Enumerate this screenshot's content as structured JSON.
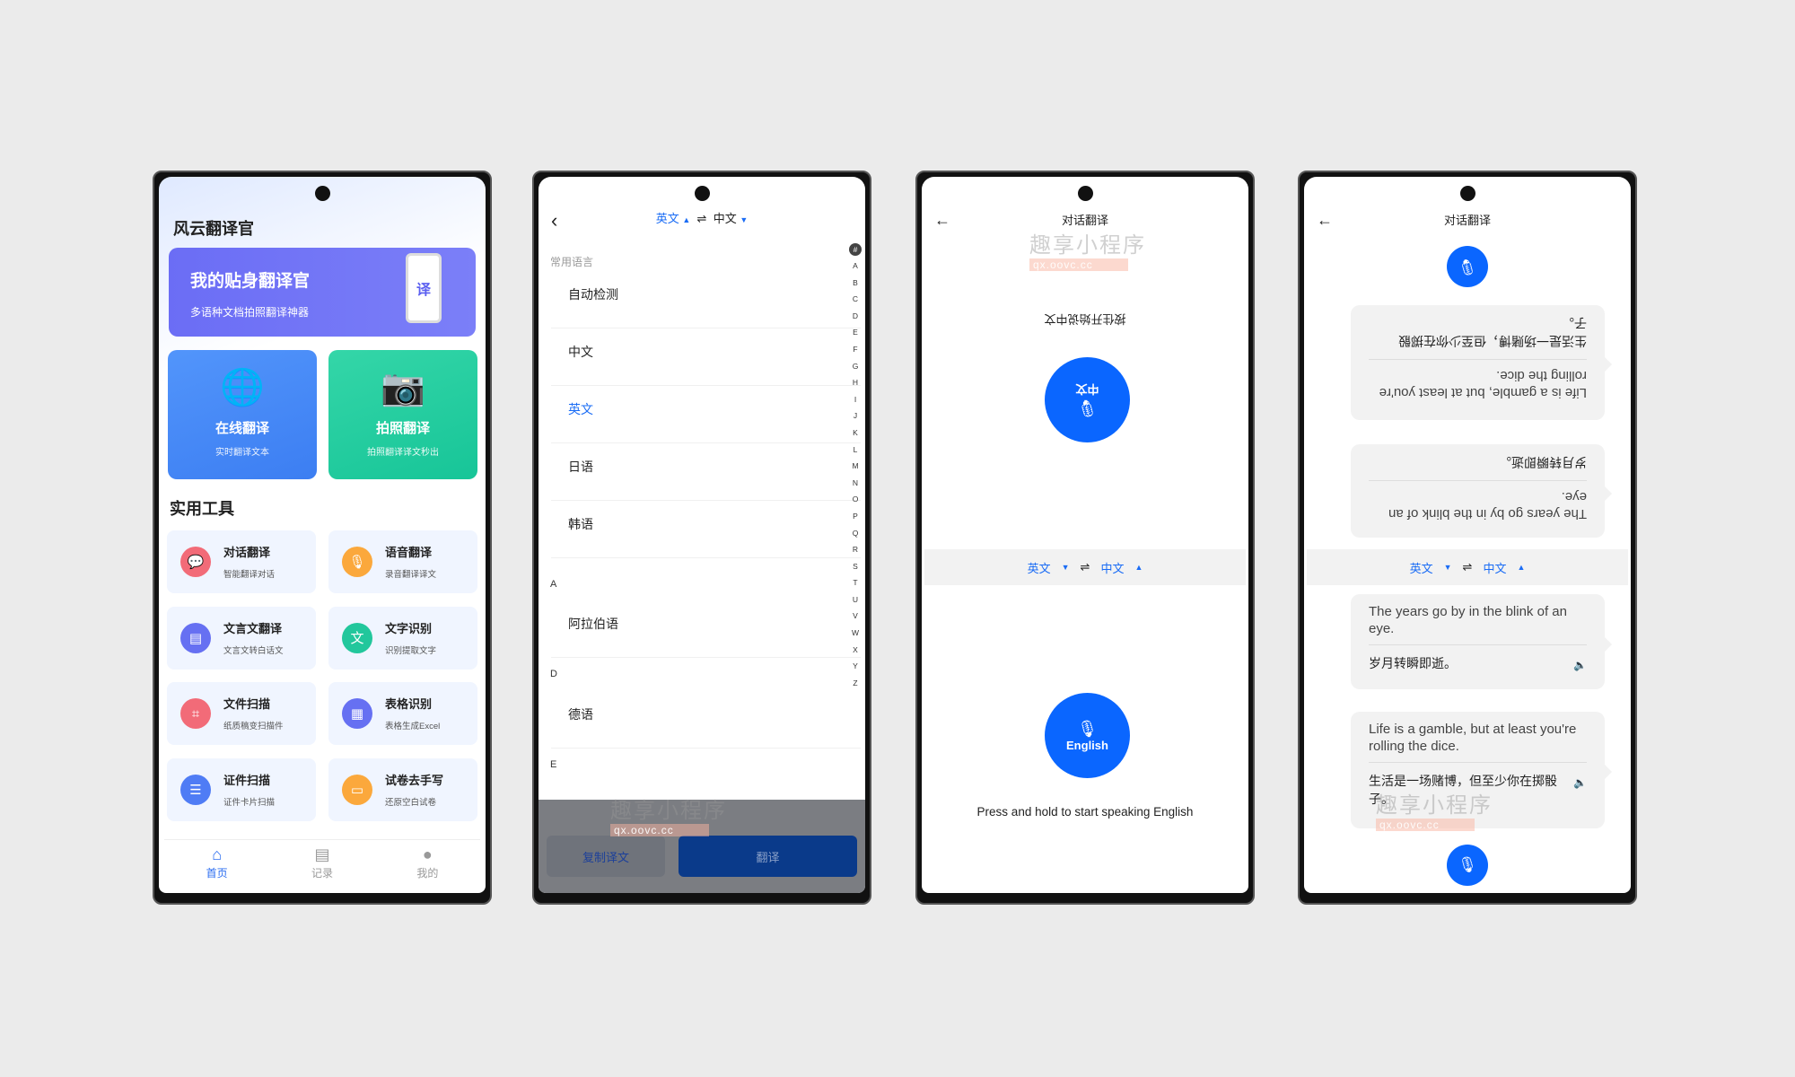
{
  "watermark": {
    "text": "趣享小程序",
    "url": "qx.oovc.cc"
  },
  "home": {
    "app_title": "风云翻译官",
    "banner": {
      "title": "我的贴身翻译官",
      "subtitle": "多语种文档拍照翻译神器",
      "badge": "译"
    },
    "cards": [
      {
        "title": "在线翻译",
        "subtitle": "实时翻译文本",
        "icon": "globe-translate-icon",
        "color": "#3f86f5"
      },
      {
        "title": "拍照翻译",
        "subtitle": "拍照翻译译文秒出",
        "icon": "camera-icon",
        "color": "#1ecb9c"
      }
    ],
    "tools_title": "实用工具",
    "tools": [
      {
        "title": "对话翻译",
        "subtitle": "智能翻译对话",
        "icon": "chat-icon",
        "color": "#f26b78"
      },
      {
        "title": "语音翻译",
        "subtitle": "录音翻译译文",
        "icon": "microphone-icon",
        "color": "#fba83c"
      },
      {
        "title": "文言文翻译",
        "subtitle": "文言文转白话文",
        "icon": "book-icon",
        "color": "#6670f2"
      },
      {
        "title": "文字识别",
        "subtitle": "识别提取文字",
        "icon": "text-scan-icon",
        "color": "#22c79c"
      },
      {
        "title": "文件扫描",
        "subtitle": "纸质稿变扫描件",
        "icon": "scan-icon",
        "color": "#f26b78"
      },
      {
        "title": "表格识别",
        "subtitle": "表格生成Excel",
        "icon": "table-icon",
        "color": "#6670f2"
      },
      {
        "title": "证件扫描",
        "subtitle": "证件卡片扫描",
        "icon": "id-card-icon",
        "color": "#4f7cf5"
      },
      {
        "title": "试卷去手写",
        "subtitle": "还原空白试卷",
        "icon": "document-icon",
        "color": "#fba83c"
      }
    ],
    "tabs": [
      {
        "label": "首页",
        "icon": "home-icon",
        "active": true
      },
      {
        "label": "记录",
        "icon": "clipboard-icon"
      },
      {
        "label": "我的",
        "icon": "user-icon"
      }
    ]
  },
  "lang_picker": {
    "source": "英文",
    "target": "中文",
    "swap": "⇌",
    "common_header": "常用语言",
    "common": [
      "自动检测",
      "中文",
      "英文",
      "日语",
      "韩语"
    ],
    "selected": "英文",
    "sections": [
      {
        "letter": "A",
        "items": [
          "阿拉伯语"
        ]
      },
      {
        "letter": "D",
        "items": [
          "德语"
        ]
      },
      {
        "letter": "E",
        "items": []
      }
    ],
    "index": [
      "#",
      "A",
      "B",
      "C",
      "D",
      "E",
      "F",
      "G",
      "H",
      "I",
      "J",
      "K",
      "L",
      "M",
      "N",
      "O",
      "P",
      "Q",
      "R",
      "S",
      "T",
      "U",
      "V",
      "W",
      "X",
      "Y",
      "Z"
    ],
    "copy_button": "复制译文",
    "translate_button": "翻译"
  },
  "conversation": {
    "title": "对话翻译",
    "top_hint": "按住开始说中文",
    "top_button": "中文",
    "source": "英文",
    "target": "中文",
    "swap": "⇌",
    "bottom_button": "English",
    "bottom_hint": "Press and hold to start speaking English"
  },
  "conversation_history": {
    "title": "对话翻译",
    "source": "英文",
    "target": "中文",
    "swap": "⇌",
    "messages": [
      {
        "en": "The years go by in the blink of an eye.",
        "zh": "岁月转瞬即逝。"
      },
      {
        "en": "Life is a gamble, but at least you're rolling the dice.",
        "zh": "生活是一场赌博，但至少你在掷骰子。"
      }
    ]
  },
  "accent": "#0a66ff"
}
